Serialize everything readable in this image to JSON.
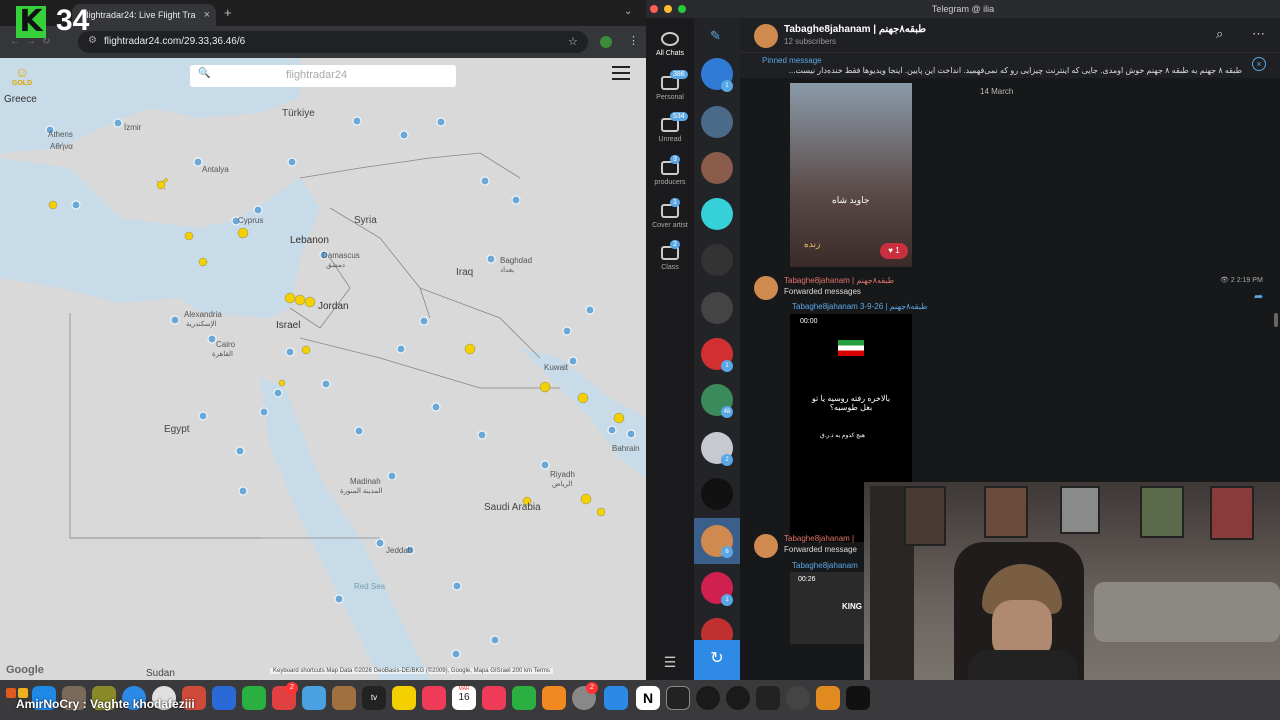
{
  "browser": {
    "tab_title": "flightradar24: Live Flight Tra",
    "url": "flightradar24.com/29.33,36.46/6",
    "stream_badge": {
      "letter": "K",
      "number": "34"
    }
  },
  "map": {
    "search_placeholder": "flightradar24",
    "gold_label": "GOLD",
    "labels": {
      "greece": "Greece",
      "turkiye": "Türkiye",
      "athens": "Athens",
      "athina": "Αθήνα",
      "izmir": "İzmir",
      "antalya": "Antalya",
      "cyprus": "Cyprus",
      "syria": "Syria",
      "lebanon": "Lebanon",
      "damascus": "Damascus",
      "damascus_ar": "دمشق",
      "baghdad": "Baghdad",
      "baghdad_ar": "بغداد",
      "iraq": "Iraq",
      "alexandria": "Alexandria",
      "alexandria_ar": "الإسكندرية",
      "cairo": "Cairo",
      "cairo_ar": "القاهرة",
      "israel": "Israel",
      "jordan": "Jordan",
      "kuwait": "Kuwait",
      "egypt": "Egypt",
      "bahrain": "Bahrain",
      "riyadh": "Riyadh",
      "riyadh_ar": "الرياض",
      "madinah": "Madinah",
      "madinah_ar": "المدينة المنورة",
      "saudi_arabia": "Saudi Arabia",
      "jeddah": "Jeddah",
      "red_sea": "Red Sea",
      "sudan": "Sudan"
    },
    "attribution": "Keyboard shortcuts   Map Data ©2026 GeoBasis-DE/BKG (©2009), Google, Mapa GISrael   200 km   Terms",
    "google_logo": "Google"
  },
  "dock": {
    "ticker": "AmirNoCry : Vaghte khodafeziii",
    "calendar_month": "MAR",
    "calendar_day": "16",
    "mail_badge": "2",
    "appstore_badge": "2"
  },
  "telegram": {
    "window_title": "Telegram @ ilia",
    "folders": [
      {
        "label": "All Chats",
        "badge": ""
      },
      {
        "label": "Personal",
        "badge": "386"
      },
      {
        "label": "Unread",
        "badge": "534"
      },
      {
        "label": "producers",
        "badge": "3"
      },
      {
        "label": "Cover artist",
        "badge": "1"
      },
      {
        "label": "Class",
        "badge": "2"
      }
    ],
    "chat_badges": {
      "c1": "1",
      "c2": "1",
      "c3": "48",
      "c4": "2",
      "c5": "1",
      "c6": "1",
      "c7": "6"
    },
    "channel": {
      "name": "Tabaghe8jahanam | طبقه۸جهنم",
      "subscribers": "12 subscribers",
      "pinned_label": "Pinned message",
      "pinned_text": "طبقه ۸ جهنم به طبقه ۸ جهنم خوش اومدی. جایی که اینترنت چیزایی رو که نمی‌فهمید. انداخت این پایین. اینجا ویدیوها فقط خنده‌دار نیست..."
    },
    "messages": {
      "date": "14 March",
      "video1_caption": "جاوید شاه",
      "video1_overlay": "زنده",
      "reaction_count": "1",
      "sender": "Tabaghe8jahanam | طبقه۸جهنم",
      "forwarded": "Forwarded messages",
      "views": "2",
      "time": "2:19 PM",
      "fwd_source": "Tabaghe8jahanam 3-9-26 | طبقه۸جهنم",
      "video2_time": "00:00",
      "video2_text": "بالاخره رفته روسیه یا تو بغل طوسیه؟",
      "video2_small": "هیچ کدوم به ذ.ر.ق",
      "sender2": "Tabaghe8jahanam |",
      "forwarded2": "Forwarded message",
      "fwd_source2": "Tabaghe8jahanam",
      "video3_time": "00:26",
      "video3_word": "KING"
    }
  }
}
